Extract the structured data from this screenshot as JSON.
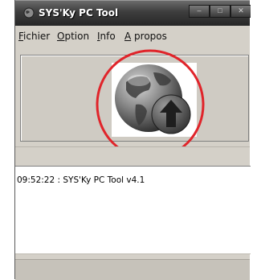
{
  "window": {
    "title": "SYS'Ky PC Tool",
    "controls": {
      "minimize": "‒",
      "maximize": "□",
      "close": "✕"
    }
  },
  "menubar": {
    "items": [
      {
        "prefix": "",
        "accel": "F",
        "rest": "ichier"
      },
      {
        "prefix": "",
        "accel": "O",
        "rest": "ption"
      },
      {
        "prefix": "",
        "accel": "I",
        "rest": "nfo"
      },
      {
        "prefix": "",
        "accel": "A",
        "rest": " propos"
      }
    ]
  },
  "main": {
    "logo_icon": "globe-upload-icon",
    "annotation": "red-circle-highlight"
  },
  "log": {
    "lines": [
      "09:52:22 : SYS'Ky PC Tool v4.1"
    ]
  },
  "colors": {
    "titlebar": "#3e3e3e",
    "window_bg": "#d4d0c8",
    "highlight": "#e0242a"
  }
}
